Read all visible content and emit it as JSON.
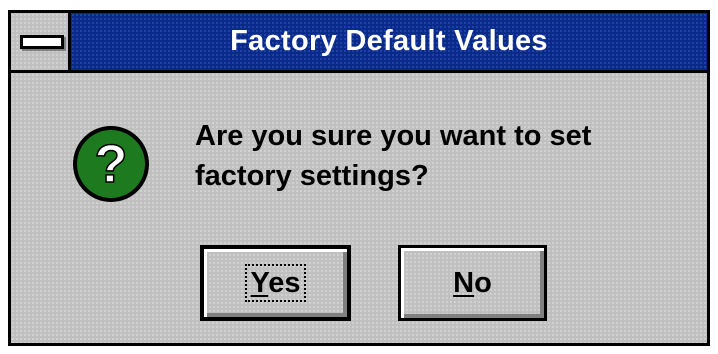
{
  "dialog": {
    "title": "Factory Default Values",
    "system_menu_icon": "minus-bar-icon",
    "message_line1": "Are you sure you want to set",
    "message_line2": "factory settings?",
    "icon": "question-icon",
    "icon_glyph": "?",
    "icon_color": "#1e7a1e"
  },
  "buttons": {
    "yes": {
      "mnemonic": "Y",
      "rest": "es",
      "label": "Yes"
    },
    "no": {
      "mnemonic": "N",
      "rest": "o",
      "label": "No"
    }
  },
  "colors": {
    "titlebar": "#0a2a8a",
    "face": "#c0c0c0",
    "title_text": "#ffffff"
  }
}
